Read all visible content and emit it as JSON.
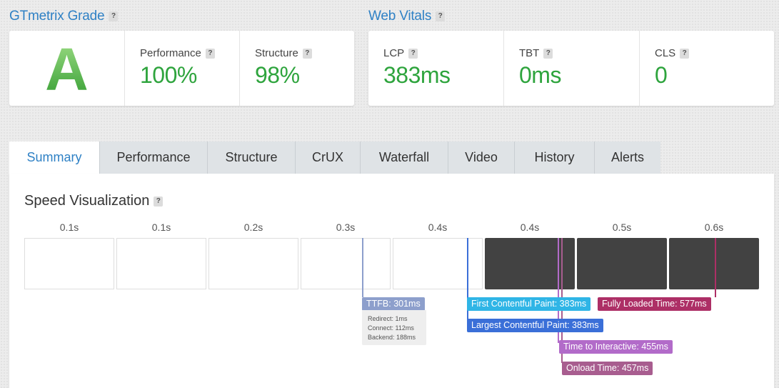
{
  "grade": {
    "title": "GTmetrix Grade",
    "help": "?",
    "letter": "A",
    "performance": {
      "label": "Performance",
      "value": "100%"
    },
    "structure": {
      "label": "Structure",
      "value": "98%"
    }
  },
  "vitals": {
    "title": "Web Vitals",
    "help": "?",
    "items": [
      {
        "label": "LCP",
        "value": "383ms"
      },
      {
        "label": "TBT",
        "value": "0ms"
      },
      {
        "label": "CLS",
        "value": "0"
      }
    ]
  },
  "tabs": [
    "Summary",
    "Performance",
    "Structure",
    "CrUX",
    "Waterfall",
    "Video",
    "History",
    "Alerts"
  ],
  "active_tab": "Summary",
  "speed": {
    "title": "Speed Visualization",
    "help": "?",
    "ticks": [
      "0.1s",
      "0.1s",
      "0.2s",
      "0.3s",
      "0.4s",
      "0.4s",
      "0.5s",
      "0.6s"
    ],
    "markers": {
      "ttfb": "TTFB: 301ms",
      "redirect": "Redirect: 1ms",
      "connect": "Connect: 112ms",
      "backend": "Backend: 188ms",
      "fcp": "First Contentful Paint: 383ms",
      "lcp": "Largest Contentful Paint: 383ms",
      "tti": "Time to Interactive: 455ms",
      "onload": "Onload Time: 457ms",
      "fully_loaded": "Fully Loaded Time: 577ms"
    }
  },
  "colors": {
    "link_blue": "#2f81c5",
    "grade_green": "#2ea43d",
    "ttfb": "#8d9fcc",
    "fcp": "#2fb5e6",
    "lcp": "#3a6fd8",
    "tti": "#b26bc9",
    "onload": "#a85d8f",
    "fully_loaded": "#ad2f66"
  }
}
